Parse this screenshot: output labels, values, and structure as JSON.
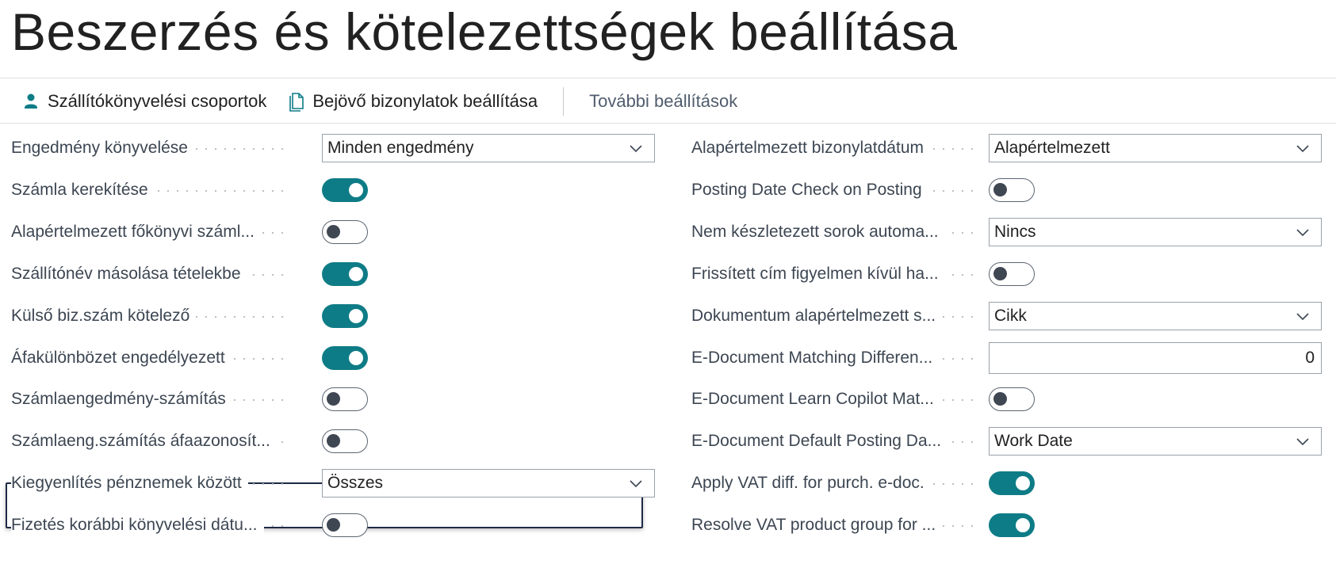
{
  "page": {
    "title": "Beszerzés és kötelezettségek beállítása"
  },
  "actions": {
    "vendor_posting_groups": "Szállítókönyvelési csoportok",
    "incoming_docs_setup": "Bejövő bizonylatok beállítása",
    "more_settings": "További beállítások"
  },
  "left_fields": [
    {
      "label": "Engedmény könyvelése",
      "type": "select",
      "value": "Minden engedmény"
    },
    {
      "label": "Számla kerekítése",
      "type": "toggle",
      "value": "on"
    },
    {
      "label": "Alapértelmezett főkönyvi száml...",
      "type": "toggle",
      "value": "off"
    },
    {
      "label": "Szállítónév másolása tételekbe",
      "type": "toggle",
      "value": "on"
    },
    {
      "label": "Külső biz.szám kötelező",
      "type": "toggle",
      "value": "on"
    },
    {
      "label": "Áfakülönbözet engedélyezett",
      "type": "toggle",
      "value": "on"
    },
    {
      "label": "Számlaengedmény-számítás",
      "type": "toggle",
      "value": "off"
    },
    {
      "label": "Számlaeng.számítás áfaazonosít...",
      "type": "toggle",
      "value": "off"
    },
    {
      "label": "Kiegyenlítés pénznemek között",
      "type": "select",
      "value": "Összes"
    },
    {
      "label": "Fizetés korábbi könyvelési dátu...",
      "type": "toggle",
      "value": "off"
    }
  ],
  "right_fields": [
    {
      "label": "Alapértelmezett bizonylatdátum",
      "type": "select",
      "value": "Alapértelmezett"
    },
    {
      "label": "Posting Date Check on Posting",
      "type": "toggle",
      "value": "off"
    },
    {
      "label": "Nem készletezett sorok automa...",
      "type": "select",
      "value": "Nincs"
    },
    {
      "label": "Frissített cím figyelmen kívül ha...",
      "type": "toggle",
      "value": "off"
    },
    {
      "label": "Dokumentum alapértelmezett s...",
      "type": "select",
      "value": "Cikk"
    },
    {
      "label": "E-Document Matching Differen...",
      "type": "input",
      "value": "0"
    },
    {
      "label": "E-Document Learn Copilot Mat...",
      "type": "toggle",
      "value": "off"
    },
    {
      "label": "E-Document Default Posting Da...",
      "type": "select",
      "value": "Work Date"
    },
    {
      "label": "Apply VAT diff. for purch. e-doc.",
      "type": "toggle",
      "value": "on"
    },
    {
      "label": "Resolve VAT product group for ...",
      "type": "toggle",
      "value": "on"
    }
  ],
  "colors": {
    "toggle_on": "#0e7c86",
    "focus_border": "#1e2a44"
  },
  "icons": {
    "vendor_posting_groups": "person-icon",
    "incoming_docs_setup": "documents-icon",
    "dropdown": "chevron-down-icon"
  }
}
